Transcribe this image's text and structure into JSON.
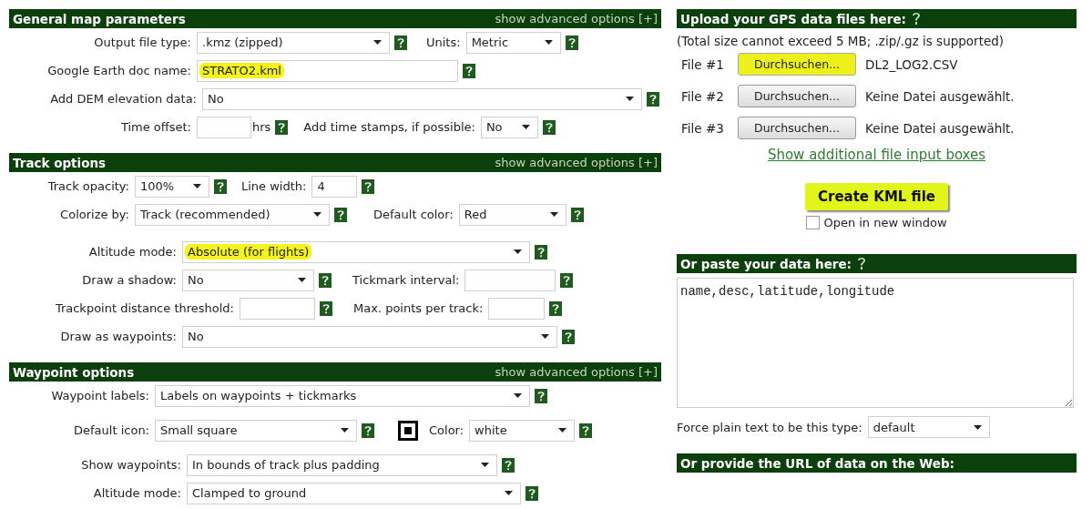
{
  "sections": [
    {
      "title": "General map parameters",
      "advanced": "show advanced options [+]",
      "rows": [
        {
          "items": [
            {
              "kind": "select",
              "label": "Output file type:",
              "value": ".kmz (zipped)"
            },
            {
              "kind": "select",
              "label": "Units:",
              "value": "Metric"
            }
          ]
        },
        {
          "items": [
            {
              "kind": "input",
              "label": "Google Earth doc name:",
              "value": "STRATO2.kml",
              "highlighted": true
            }
          ]
        },
        {
          "items": [
            {
              "kind": "select",
              "label": "Add DEM elevation data:",
              "value": "No"
            }
          ]
        },
        {
          "items": [
            {
              "kind": "input",
              "label": "Time offset:",
              "suffix": "hrs"
            },
            {
              "kind": "select",
              "label": "Add time stamps, if possible:",
              "value": "No"
            }
          ]
        }
      ]
    },
    {
      "title": "Track options",
      "advanced": "show advanced options [+]",
      "rows": [
        {
          "items": [
            {
              "kind": "select",
              "label": "Track opacity:",
              "value": "100%"
            },
            {
              "kind": "input",
              "label": "Line width:",
              "value": "4"
            }
          ]
        },
        {
          "items": [
            {
              "kind": "select",
              "label": "Colorize by:",
              "value": "Track (recommended)"
            },
            {
              "kind": "select",
              "label": "Default color:",
              "value": "Red"
            }
          ]
        },
        {
          "items": [
            {
              "kind": "select",
              "label": "Altitude mode:",
              "value": "Absolute (for flights)",
              "highlighted": true
            }
          ]
        },
        {
          "items": [
            {
              "kind": "select",
              "label": "Draw a shadow:",
              "value": "No"
            },
            {
              "kind": "input",
              "label": "Tickmark interval:"
            }
          ]
        },
        {
          "items": [
            {
              "kind": "input",
              "label": "Trackpoint distance threshold:"
            },
            {
              "kind": "input",
              "label": "Max. points per track:"
            }
          ]
        },
        {
          "items": [
            {
              "kind": "select",
              "label": "Draw as waypoints:",
              "value": "No"
            }
          ]
        }
      ]
    },
    {
      "title": "Waypoint options",
      "advanced": "show advanced options [+]",
      "rows": [
        {
          "items": [
            {
              "kind": "select",
              "label": "Waypoint labels:",
              "value": "Labels on waypoints + tickmarks"
            }
          ]
        },
        {
          "items": [
            {
              "kind": "select",
              "label": "Default icon:",
              "value": "Small square"
            },
            {
              "kind": "preview"
            },
            {
              "kind": "select",
              "label": "Color:",
              "value": "white"
            }
          ]
        },
        {
          "items": [
            {
              "kind": "select",
              "label": "Show waypoints:",
              "value": "In bounds of track plus padding"
            }
          ]
        },
        {
          "items": [
            {
              "kind": "select",
              "label": "Altitude mode:",
              "value": "Clamped to ground"
            }
          ]
        }
      ]
    }
  ],
  "upload": {
    "title": "Upload your GPS data files here:",
    "note": "(Total size cannot exceed 5 MB; .zip/.gz is supported)",
    "files": [
      {
        "label": "File #1",
        "button": "Durchsuchen...",
        "highlighted": true,
        "filename": "DL2_LOG2.CSV"
      },
      {
        "label": "File #2",
        "button": "Durchsuchen...",
        "highlighted": false,
        "filename": "Keine Datei ausgewählt."
      },
      {
        "label": "File #3",
        "button": "Durchsuchen...",
        "highlighted": false,
        "filename": "Keine Datei ausgewählt."
      }
    ],
    "link": "Show additional file input boxes",
    "create": {
      "label": "Create KML file",
      "highlighted": true
    },
    "new_window": {
      "label": "Open in new window",
      "checked": false
    }
  },
  "paste": {
    "title": "Or paste your data here:",
    "value": "name,desc,latitude,longitude",
    "force_label": "Force plain text to be this type:",
    "force_value": "default"
  },
  "url": {
    "title": "Or provide the URL of data on the Web:"
  }
}
